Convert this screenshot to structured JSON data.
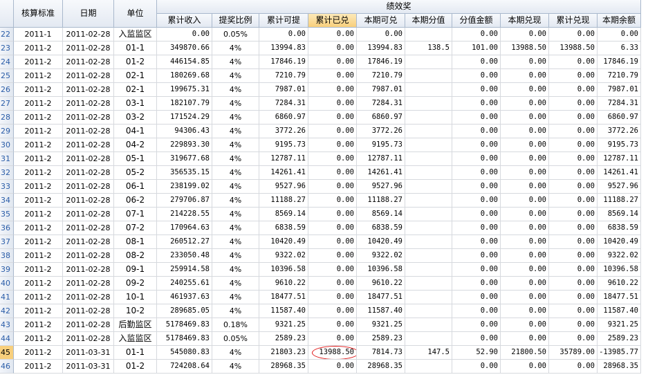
{
  "headers": {
    "row_num": "",
    "standard": "核算标准",
    "date": "日期",
    "unit": "单位",
    "group": "绩效奖",
    "cols": [
      "累计收入",
      "提奖比例",
      "累计可提",
      "累计已兑",
      "本期可兑",
      "本期分值",
      "分值金额",
      "本期兑现",
      "累计兑现",
      "本期余额"
    ]
  },
  "rows": [
    {
      "n": "22",
      "std": "2011-1",
      "date": "2011-02-28",
      "unit": "入监监区",
      "v": [
        "0.00",
        "0.05%",
        "0.00",
        "0.00",
        "0.00",
        "",
        "0.00",
        "0.00",
        "0.00",
        "0.00"
      ]
    },
    {
      "n": "23",
      "std": "2011-2",
      "date": "2011-02-28",
      "unit": "01-1",
      "v": [
        "349870.66",
        "4%",
        "13994.83",
        "0.00",
        "13994.83",
        "138.5",
        "101.00",
        "13988.50",
        "13988.50",
        "6.33"
      ]
    },
    {
      "n": "24",
      "std": "2011-2",
      "date": "2011-02-28",
      "unit": "01-2",
      "v": [
        "446154.85",
        "4%",
        "17846.19",
        "0.00",
        "17846.19",
        "",
        "0.00",
        "0.00",
        "0.00",
        "17846.19"
      ]
    },
    {
      "n": "25",
      "std": "2011-2",
      "date": "2011-02-28",
      "unit": "02-1",
      "v": [
        "180269.68",
        "4%",
        "7210.79",
        "0.00",
        "7210.79",
        "",
        "0.00",
        "0.00",
        "0.00",
        "7210.79"
      ]
    },
    {
      "n": "26",
      "std": "2011-2",
      "date": "2011-02-28",
      "unit": "02-1",
      "v": [
        "199675.31",
        "4%",
        "7987.01",
        "0.00",
        "7987.01",
        "",
        "0.00",
        "0.00",
        "0.00",
        "7987.01"
      ]
    },
    {
      "n": "27",
      "std": "2011-2",
      "date": "2011-02-28",
      "unit": "03-1",
      "v": [
        "182107.79",
        "4%",
        "7284.31",
        "0.00",
        "7284.31",
        "",
        "0.00",
        "0.00",
        "0.00",
        "7284.31"
      ]
    },
    {
      "n": "28",
      "std": "2011-2",
      "date": "2011-02-28",
      "unit": "03-2",
      "v": [
        "171524.29",
        "4%",
        "6860.97",
        "0.00",
        "6860.97",
        "",
        "0.00",
        "0.00",
        "0.00",
        "6860.97"
      ]
    },
    {
      "n": "29",
      "std": "2011-2",
      "date": "2011-02-28",
      "unit": "04-1",
      "v": [
        "94306.43",
        "4%",
        "3772.26",
        "0.00",
        "3772.26",
        "",
        "0.00",
        "0.00",
        "0.00",
        "3772.26"
      ]
    },
    {
      "n": "30",
      "std": "2011-2",
      "date": "2011-02-28",
      "unit": "04-2",
      "v": [
        "229893.30",
        "4%",
        "9195.73",
        "0.00",
        "9195.73",
        "",
        "0.00",
        "0.00",
        "0.00",
        "9195.73"
      ]
    },
    {
      "n": "31",
      "std": "2011-2",
      "date": "2011-02-28",
      "unit": "05-1",
      "v": [
        "319677.68",
        "4%",
        "12787.11",
        "0.00",
        "12787.11",
        "",
        "0.00",
        "0.00",
        "0.00",
        "12787.11"
      ]
    },
    {
      "n": "32",
      "std": "2011-2",
      "date": "2011-02-28",
      "unit": "05-2",
      "v": [
        "356535.15",
        "4%",
        "14261.41",
        "0.00",
        "14261.41",
        "",
        "0.00",
        "0.00",
        "0.00",
        "14261.41"
      ]
    },
    {
      "n": "33",
      "std": "2011-2",
      "date": "2011-02-28",
      "unit": "06-1",
      "v": [
        "238199.02",
        "4%",
        "9527.96",
        "0.00",
        "9527.96",
        "",
        "0.00",
        "0.00",
        "0.00",
        "9527.96"
      ]
    },
    {
      "n": "34",
      "std": "2011-2",
      "date": "2011-02-28",
      "unit": "06-2",
      "v": [
        "279706.87",
        "4%",
        "11188.27",
        "0.00",
        "11188.27",
        "",
        "0.00",
        "0.00",
        "0.00",
        "11188.27"
      ]
    },
    {
      "n": "35",
      "std": "2011-2",
      "date": "2011-02-28",
      "unit": "07-1",
      "v": [
        "214228.55",
        "4%",
        "8569.14",
        "0.00",
        "8569.14",
        "",
        "0.00",
        "0.00",
        "0.00",
        "8569.14"
      ]
    },
    {
      "n": "36",
      "std": "2011-2",
      "date": "2011-02-28",
      "unit": "07-2",
      "v": [
        "170964.63",
        "4%",
        "6838.59",
        "0.00",
        "6838.59",
        "",
        "0.00",
        "0.00",
        "0.00",
        "6838.59"
      ]
    },
    {
      "n": "37",
      "std": "2011-2",
      "date": "2011-02-28",
      "unit": "08-1",
      "v": [
        "260512.27",
        "4%",
        "10420.49",
        "0.00",
        "10420.49",
        "",
        "0.00",
        "0.00",
        "0.00",
        "10420.49"
      ]
    },
    {
      "n": "38",
      "std": "2011-2",
      "date": "2011-02-28",
      "unit": "08-2",
      "v": [
        "233050.48",
        "4%",
        "9322.02",
        "0.00",
        "9322.02",
        "",
        "0.00",
        "0.00",
        "0.00",
        "9322.02"
      ]
    },
    {
      "n": "39",
      "std": "2011-2",
      "date": "2011-02-28",
      "unit": "09-1",
      "v": [
        "259914.58",
        "4%",
        "10396.58",
        "0.00",
        "10396.58",
        "",
        "0.00",
        "0.00",
        "0.00",
        "10396.58"
      ]
    },
    {
      "n": "40",
      "std": "2011-2",
      "date": "2011-02-28",
      "unit": "09-2",
      "v": [
        "240255.61",
        "4%",
        "9610.22",
        "0.00",
        "9610.22",
        "",
        "0.00",
        "0.00",
        "0.00",
        "9610.22"
      ]
    },
    {
      "n": "41",
      "std": "2011-2",
      "date": "2011-02-28",
      "unit": "10-1",
      "v": [
        "461937.63",
        "4%",
        "18477.51",
        "0.00",
        "18477.51",
        "",
        "0.00",
        "0.00",
        "0.00",
        "18477.51"
      ]
    },
    {
      "n": "42",
      "std": "2011-2",
      "date": "2011-02-28",
      "unit": "10-2",
      "v": [
        "289685.05",
        "4%",
        "11587.40",
        "0.00",
        "11587.40",
        "",
        "0.00",
        "0.00",
        "0.00",
        "11587.40"
      ]
    },
    {
      "n": "43",
      "std": "2011-2",
      "date": "2011-02-28",
      "unit": "后勤监区",
      "v": [
        "5178469.83",
        "0.18%",
        "9321.25",
        "0.00",
        "9321.25",
        "",
        "0.00",
        "0.00",
        "0.00",
        "9321.25"
      ]
    },
    {
      "n": "44",
      "std": "2011-2",
      "date": "2011-02-28",
      "unit": "入监监区",
      "v": [
        "5178469.83",
        "0.05%",
        "2589.23",
        "0.00",
        "2589.23",
        "",
        "0.00",
        "0.00",
        "0.00",
        "2589.23"
      ]
    },
    {
      "n": "45",
      "std": "2011-2",
      "date": "2011-03-31",
      "unit": "01-1",
      "v": [
        "545080.83",
        "4%",
        "21803.23",
        "13988.50",
        "7814.73",
        "147.5",
        "52.90",
        "21800.50",
        "35789.00",
        "-13985.77"
      ]
    },
    {
      "n": "46",
      "std": "2011-2",
      "date": "2011-03-31",
      "unit": "01-2",
      "v": [
        "724208.64",
        "4%",
        "28968.35",
        "0.00",
        "28968.35",
        "",
        "0.00",
        "0.00",
        "0.00",
        "28968.35"
      ]
    }
  ],
  "selected_row": "45",
  "highlight_color": "#e01616"
}
